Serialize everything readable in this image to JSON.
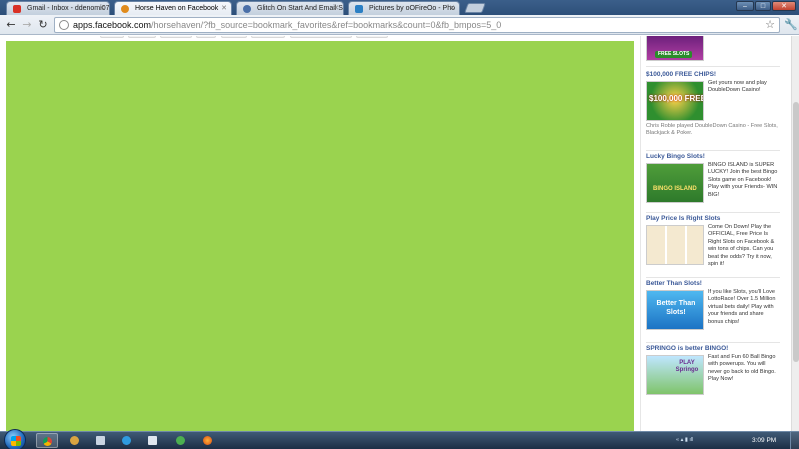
{
  "browser": {
    "tabs": [
      {
        "label": "Gmail - Inbox - ddenomi07",
        "icon": "gmail-icon",
        "active": false
      },
      {
        "label": "Horse Haven on Facebook",
        "icon": "horse-haven-icon",
        "active": true
      },
      {
        "label": "Glitch On Start And Email S",
        "icon": "forum-icon",
        "active": false
      },
      {
        "label": "Pictures by oOFireOo - Pho",
        "icon": "photobucket-icon",
        "active": false
      }
    ],
    "window_controls": {
      "minimize": "–",
      "maximize": "□",
      "close": "✕"
    },
    "url": {
      "host": "apps.facebook.com",
      "path": "/horsehaven/?fb_source=bookmark_favorites&ref=bookmarks&count=0&fb_bmpos=5_0"
    }
  },
  "sidebar": {
    "top_ad": {
      "thumb_label": "FREE SLOTS"
    },
    "ads": [
      {
        "title": "$100,000 FREE CHIPS!",
        "body": "Get yours now and play DoubleDown Casino!",
        "social": "Chris Roble played DoubleDown Casino - Free Slots, Blackjack & Poker.",
        "thumb_text": "$100,000 FREE CHIPS!"
      },
      {
        "title": "Lucky Bingo Slots!",
        "body": "BINGO ISLAND is SUPER LUCKY! Join the best Bingo Slots game on Facebook! Play with your Friends- WIN BIG!",
        "thumb_text": "BINGO ISLAND"
      },
      {
        "title": "Play Price Is Right Slots",
        "body": "Come On Down! Play the OFFICIAL, Free Price Is Right Slots on Facebook & win tons of chips. Can you beat the odds? Try it now, spin it!",
        "thumb_text": ""
      },
      {
        "title": "Better Than Slots!",
        "body": "If you like Slots, you'll Love LottoRace! Over 1.5 Million virtual bets daily! Play with your friends and share bonus chips!",
        "thumb_text": "Better Than Slots!"
      },
      {
        "title": "SPRINGO is better BINGO!",
        "body": "Fast and Fun 60 Ball Bingo with powerups. You will never go back to old Bingo. Play Now!",
        "thumb_text": "PLAY Springo"
      }
    ]
  },
  "taskbar": {
    "time": "3:09 PM",
    "tray_text": "«  ▴  ▮  ıll"
  },
  "colors": {
    "game_background": "#9ad34f",
    "ad_title": "#3b5998"
  }
}
